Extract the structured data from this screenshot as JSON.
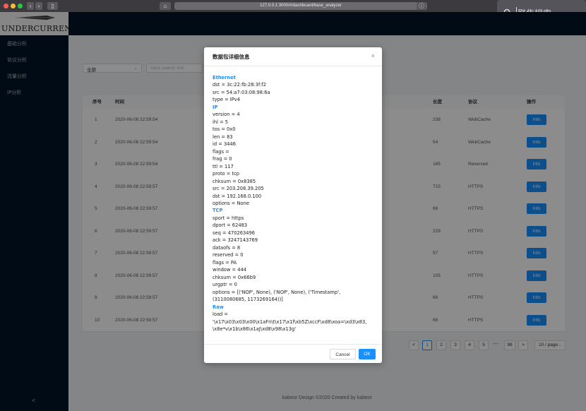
{
  "browser": {
    "url": "127.0.0.1:3000/#/dashboard/base_analyzer",
    "search_placeholder": "聚焦搜索"
  },
  "sidebar": {
    "logo_text": "UNDERCURRENT",
    "items": [
      {
        "label": "基础分析"
      },
      {
        "label": "协议分析"
      },
      {
        "label": "流量分析"
      },
      {
        "label": "IP分析"
      }
    ],
    "collapse_label": "<"
  },
  "filters": {
    "select_value": "全部",
    "search_placeholder": "input search text"
  },
  "table": {
    "headers": {
      "index": "序号",
      "time": "时间",
      "length": "长度",
      "protocol": "协议",
      "action": "操作"
    },
    "rows": [
      {
        "index": "1",
        "time": "2020-06-08 22:59:54",
        "length": "238",
        "protocol": "WebCache",
        "action": "Info"
      },
      {
        "index": "2",
        "time": "2020-06-08 22:59:54",
        "length": "54",
        "protocol": "WebCache",
        "action": "Info"
      },
      {
        "index": "3",
        "time": "2020-06-08 22:59:54",
        "length": "185",
        "protocol": "Reserved",
        "action": "Info"
      },
      {
        "index": "4",
        "time": "2020-06-08 22:59:57",
        "length": "715",
        "protocol": "HTTPS",
        "action": "Info"
      },
      {
        "index": "5",
        "time": "2020-06-08 22:59:57",
        "length": "66",
        "protocol": "HTTPS",
        "action": "Info"
      },
      {
        "index": "6",
        "time": "2020-06-08 22:59:57",
        "length": "229",
        "protocol": "HTTPS",
        "action": "Info"
      },
      {
        "index": "7",
        "time": "2020-06-08 22:59:57",
        "length": "97",
        "protocol": "HTTPS",
        "action": "Info"
      },
      {
        "index": "8",
        "time": "2020-06-08 22:59:57",
        "length": "105",
        "protocol": "HTTPS",
        "action": "Info"
      },
      {
        "index": "9",
        "time": "2020-06-08 22:59:57",
        "length": "66",
        "protocol": "HTTPS",
        "action": "Info"
      },
      {
        "index": "10",
        "time": "2020-06-08 22:59:57",
        "length": "66",
        "protocol": "HTTPS",
        "action": "Info"
      }
    ]
  },
  "pagination": {
    "prev": "<",
    "pages": [
      "1",
      "2",
      "3",
      "4",
      "5"
    ],
    "ellipsis": "•••",
    "last": "98",
    "next": ">",
    "page_size": "10 / page"
  },
  "footer": "kabeor Design ©2020 Created by kabeor",
  "modal": {
    "title": "数据包详细信息",
    "close": "×",
    "lines": [
      {
        "text": "Ethernet",
        "section": true
      },
      {
        "text": "dst = 3c:22:fb:28:3f:f2"
      },
      {
        "text": "src = 54:a7:03:08:98:6a"
      },
      {
        "text": "type = IPv4"
      },
      {
        "text": "IP",
        "section": true
      },
      {
        "text": "version = 4"
      },
      {
        "text": "ihl = 5"
      },
      {
        "text": "tos = 0x0"
      },
      {
        "text": "len = 83"
      },
      {
        "text": "id = 3446"
      },
      {
        "text": "flags ="
      },
      {
        "text": "frag = 0"
      },
      {
        "text": "ttl = 117"
      },
      {
        "text": "proto = tcp"
      },
      {
        "text": "chksum = 0x8385"
      },
      {
        "text": "src = 203.208.39.205"
      },
      {
        "text": "dst = 192.168.0.100"
      },
      {
        "text": "options = None"
      },
      {
        "text": "TCP",
        "section": true
      },
      {
        "text": "sport = https"
      },
      {
        "text": "dport = 62483"
      },
      {
        "text": "seq = 470263496"
      },
      {
        "text": "ack = 3247143769"
      },
      {
        "text": "dataofs = 8"
      },
      {
        "text": "reserved = 0"
      },
      {
        "text": "flags = PA"
      },
      {
        "text": "window = 444"
      },
      {
        "text": "chksum = 0x66b9"
      },
      {
        "text": "urgptr = 0"
      },
      {
        "text": "options = [('NOP', None), ('NOP', None), ('Timestamp',"
      },
      {
        "text": "(3110080685, 1173269164))]"
      },
      {
        "text": "Raw",
        "section": true
      },
      {
        "text": "load ="
      },
      {
        "text": "'\\x17\\x03\\x03\\x00\\x1aFn\\t\\x17\\x1f\\xb5Z\\xccF\\xd8\\xoa=\\xd3\\x83,"
      },
      {
        "text": "\\x8e*v\\x1b\\x86\\x1aJ\\xd8\\x98\\x13g'"
      }
    ],
    "cancel_label": "Cancel",
    "ok_label": "OK"
  },
  "colors": {
    "primary": "#1890ff",
    "sidebar_bg": "#001529"
  }
}
